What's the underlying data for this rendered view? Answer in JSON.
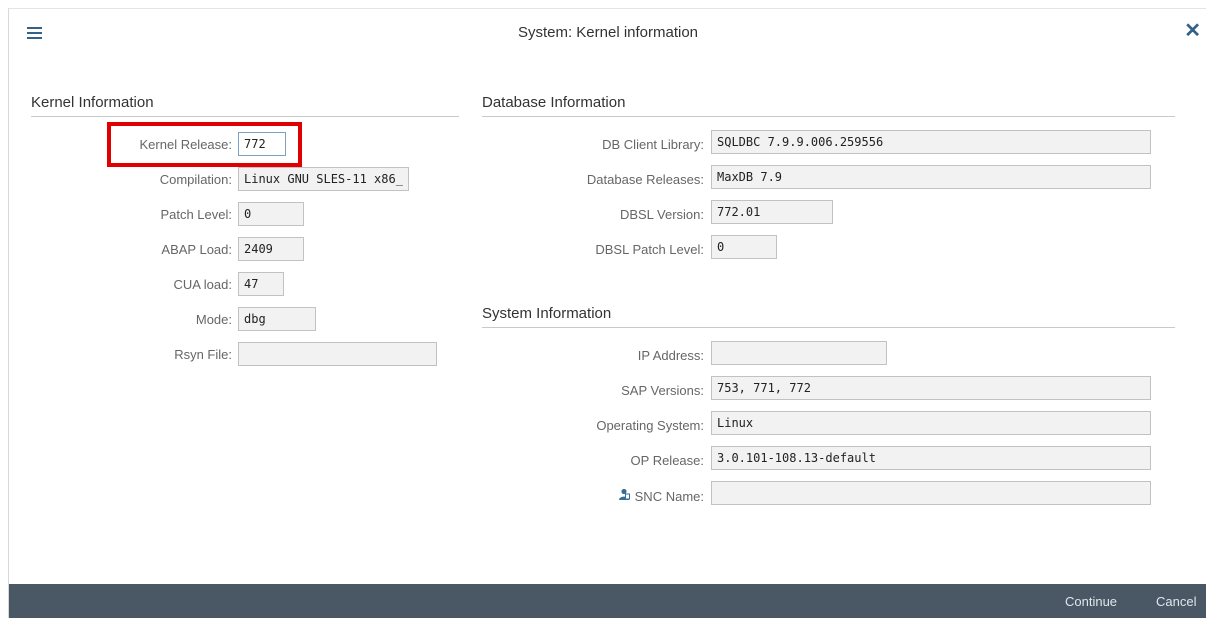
{
  "window": {
    "title": "System: Kernel information"
  },
  "kernel": {
    "section_title": "Kernel Information",
    "fields": [
      {
        "label": "Kernel Release:",
        "value": "772"
      },
      {
        "label": "Compilation:",
        "value": "Linux GNU SLES-11 x86_"
      },
      {
        "label": "Patch Level:",
        "value": "0"
      },
      {
        "label": "ABAP Load:",
        "value": "2409"
      },
      {
        "label": "CUA load:",
        "value": "47"
      },
      {
        "label": "Mode:",
        "value": "dbg"
      },
      {
        "label": "Rsyn File:",
        "value": ""
      }
    ]
  },
  "database": {
    "section_title": "Database Information",
    "fields": [
      {
        "label": "DB Client Library:",
        "value": "SQLDBC 7.9.9.006.259556"
      },
      {
        "label": "Database Releases:",
        "value": "MaxDB 7.9"
      },
      {
        "label": "DBSL Version:",
        "value": "772.01"
      },
      {
        "label": "DBSL Patch Level:",
        "value": "0"
      }
    ]
  },
  "system": {
    "section_title": "System Information",
    "fields": [
      {
        "label": "IP Address:",
        "value": ""
      },
      {
        "label": "SAP Versions:",
        "value": "753, 771, 772"
      },
      {
        "label": "Operating System:",
        "value": "Linux"
      },
      {
        "label": "OP Release:",
        "value": "3.0.101-108.13-default"
      },
      {
        "label": "SNC Name:",
        "value": ""
      }
    ]
  },
  "footer": {
    "continue_label": "Continue",
    "cancel_label": "Cancel"
  },
  "icons": {
    "menu": "hamburger-icon",
    "close": "close-icon",
    "snc": "snc-user-icon"
  },
  "colors": {
    "accent": "#346187",
    "footer_bg": "#4a5866",
    "highlight": "#e00000"
  }
}
